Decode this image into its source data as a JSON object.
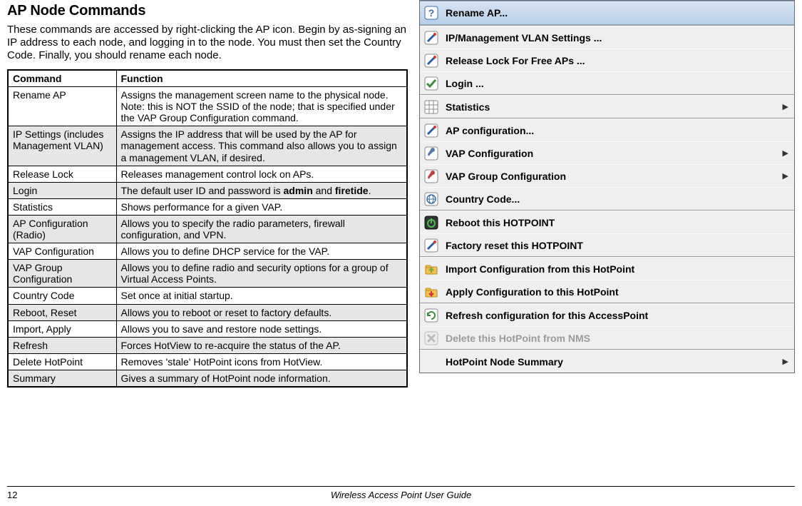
{
  "heading": "AP Node Commands",
  "intro": "These commands are accessed by right-clicking the AP icon. Begin by as-signing an IP address to each node, and logging in to the node. You must then set the Country Code. Finally, you should rename each node.",
  "table": {
    "headers": [
      "Command",
      "Function"
    ],
    "rows": [
      {
        "c": "Rename AP",
        "f": "Assigns the management screen name to the physical node. Note: this is NOT the SSID of the node; that is specified under the VAP Group Configuration command."
      },
      {
        "c": "IP Settings (includes Management VLAN)",
        "f": "Assigns the IP address that will be used by the AP for management access. This command also allows you to assign a management VLAN, if desired."
      },
      {
        "c": "Release Lock",
        "f": "Releases management control lock on APs."
      },
      {
        "c": "Login",
        "f_html": "The default user ID and password is <b>admin</b> and <b>firetide</b>."
      },
      {
        "c": "Statistics",
        "f": "Shows performance for a given VAP."
      },
      {
        "c": "AP Configuration (Radio)",
        "f": "Allows you to specify the radio parameters, firewall configuration, and VPN."
      },
      {
        "c": "VAP Configuration",
        "f": "Allows you to define DHCP service for the VAP."
      },
      {
        "c": "VAP Group Configuration",
        "f": "Allows you to define radio and security options for a group of  Virtual Access Points."
      },
      {
        "c": "Country Code",
        "f": "Set once at initial startup."
      },
      {
        "c": "Reboot, Reset",
        "f": "Allows you to reboot or reset to factory defaults."
      },
      {
        "c": "Import, Apply",
        "f": "Allows you to save and restore node settings."
      },
      {
        "c": "Refresh",
        "f": "Forces HotView to re-acquire the status of the AP."
      },
      {
        "c": "Delete HotPoint",
        "f": "Removes 'stale' HotPoint icons from HotView."
      },
      {
        "c": "Summary",
        "f": "Gives a summary of HotPoint node information."
      }
    ]
  },
  "menu": {
    "groups": [
      [
        {
          "icon": "question-icon",
          "label": "Rename AP...",
          "highlight": true,
          "arrow": false
        }
      ],
      [
        {
          "icon": "pencil-icon",
          "label": "IP/Management VLAN Settings ...",
          "arrow": false
        },
        {
          "icon": "pencil-icon",
          "label": "Release Lock For Free APs ...",
          "arrow": false
        },
        {
          "icon": "check-icon",
          "label": "Login ...",
          "arrow": false
        }
      ],
      [
        {
          "icon": "grid-icon",
          "label": "Statistics",
          "arrow": true
        }
      ],
      [
        {
          "icon": "pencil-icon",
          "label": "AP configuration...",
          "arrow": false
        },
        {
          "icon": "wrench-icon",
          "label": "VAP Configuration",
          "arrow": true
        },
        {
          "icon": "wrench-red-icon",
          "label": "VAP Group Configuration",
          "arrow": true
        },
        {
          "icon": "globe-icon",
          "label": "Country Code...",
          "arrow": false
        }
      ],
      [
        {
          "icon": "power-icon",
          "label": "Reboot this HOTPOINT",
          "arrow": false
        },
        {
          "icon": "pencil-icon",
          "label": "Factory reset this HOTPOINT",
          "arrow": false
        }
      ],
      [
        {
          "icon": "folder-up-icon",
          "label": "Import Configuration from this HotPoint",
          "arrow": false
        },
        {
          "icon": "folder-down-icon",
          "label": "Apply Configuration to this HotPoint",
          "arrow": false
        }
      ],
      [
        {
          "icon": "refresh-icon",
          "label": "Refresh configuration for this AccessPoint",
          "arrow": false
        },
        {
          "icon": "delete-icon",
          "label": "Delete this HotPoint from NMS",
          "arrow": false,
          "disabled": true
        }
      ],
      [
        {
          "icon": "blank-icon",
          "label": "HotPoint Node Summary",
          "arrow": true
        }
      ]
    ]
  },
  "footer": {
    "page": "12",
    "guide": "Wireless Access Point User Guide"
  }
}
